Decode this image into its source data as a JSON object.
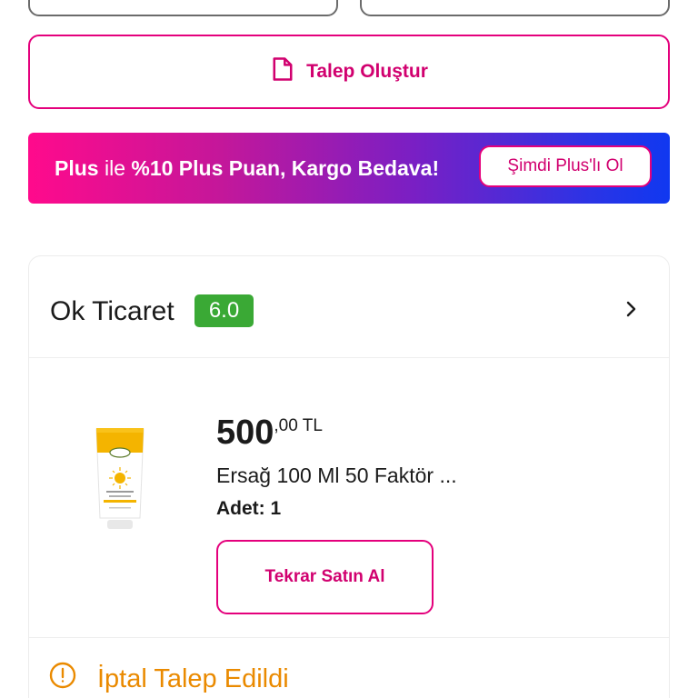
{
  "talep_button": {
    "label": "Talep Oluştur",
    "icon": "document-icon"
  },
  "plus_banner": {
    "part1": "Plus",
    "part2": " ile ",
    "part3": "%10 Plus Puan, Kargo Bedava!",
    "cta": "Şimdi Plus'lı Ol"
  },
  "order": {
    "seller": "Ok Ticaret",
    "rating": "6.0",
    "price_main": "500",
    "price_fraction": ",00 TL",
    "product_name": "Ersağ 100 Ml 50 Faktör ...",
    "quantity": "Adet: 1",
    "rebuy_label": "Tekrar Satın Al",
    "status": "İptal Talep Edildi"
  },
  "colors": {
    "brand": "#e4007c",
    "rating": "#3aa935",
    "status": "#ea8a00"
  }
}
